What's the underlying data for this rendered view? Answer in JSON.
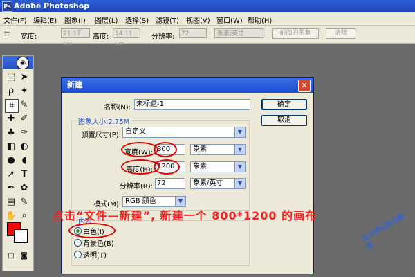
{
  "app": {
    "title": "Adobe Photoshop",
    "icon": "photoshop-icon"
  },
  "menu": [
    "文件(F)",
    "编辑(E)",
    "图象(I)",
    "图层(L)",
    "选择(S)",
    "滤镜(T)",
    "视图(V)",
    "窗口(W)",
    "帮助(H)"
  ],
  "options": {
    "width_label": "宽度:",
    "width_value": "21.17 cm",
    "height_label": "高度:",
    "height_value": "14.11 cm",
    "resolution_label": "分辨率:",
    "resolution_value": "72",
    "unit_value": "象素/英寸",
    "front_image_label": "前面的图象",
    "clear_label": "清除"
  },
  "dialog": {
    "title": "新建",
    "name_label": "名称(N):",
    "name_value": "未标题-1",
    "ok_label": "确定",
    "cancel_label": "取消",
    "image_size_label": "图象大小:2.75M",
    "preset_label": "预置尺寸(P):",
    "preset_value": "自定义",
    "width_label": "宽度(W):",
    "width_value": "800",
    "width_unit": "象素",
    "height_label": "高度(H):",
    "height_value": "1200",
    "height_unit": "象素",
    "resolution_label": "分辨率(R):",
    "resolution_value": "72",
    "resolution_unit": "象素/英寸",
    "mode_label": "模式(M):",
    "mode_value": "RGB 颜色",
    "contents_label": "内容",
    "contents_options": [
      "白色(I)",
      "背景色(B)",
      "透明(T)"
    ],
    "contents_selected": "白色(I)"
  },
  "annotation": "点击“文件—新建”, 新建一个 800*1200 的画布",
  "watermark": "宝贝梦幻制作教程",
  "colors": {
    "foreground": "#ff0000",
    "background": "#ffffff",
    "annotation": "#ff2020"
  }
}
